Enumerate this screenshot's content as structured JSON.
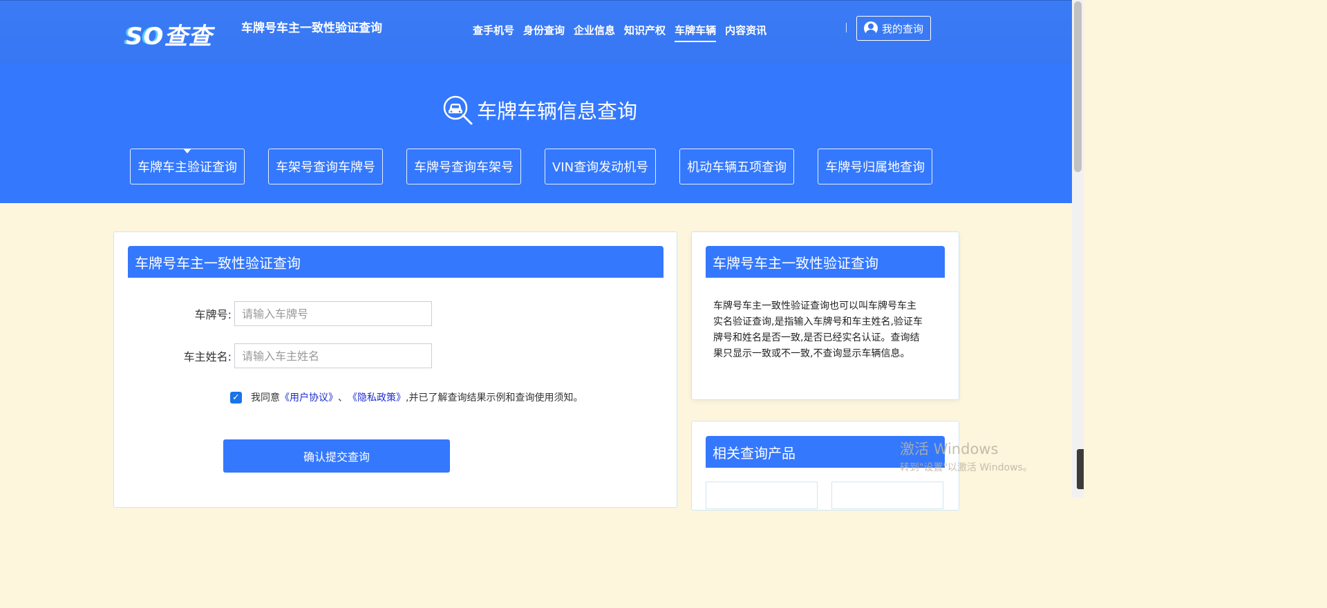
{
  "header": {
    "logo_text": "SO查查",
    "brand_title": "车牌号车主一致性验证查询",
    "nav": [
      "查手机号",
      "身份查询",
      "企业信息",
      "知识产权",
      "车牌车辆",
      "内容资讯"
    ],
    "nav_active": "车牌车辆",
    "my_query_label": "我的查询"
  },
  "hero": {
    "title": "车牌车辆信息查询",
    "icon": "car-search-icon",
    "tabs": [
      "车牌车主验证查询",
      "车架号查询车牌号",
      "车牌号查询车架号",
      "VIN查询发动机号",
      "机动车辆五项查询",
      "车牌号归属地查询"
    ]
  },
  "form": {
    "title": "车牌号车主一致性验证查询",
    "plate_label": "车牌号:",
    "plate_placeholder": "请输入车牌号",
    "owner_label": "车主姓名:",
    "owner_placeholder": "请输入车主姓名",
    "agree_prefix": "我同意",
    "user_agreement": "《用户协议》",
    "separator": "、",
    "privacy_policy": "《隐私政策》",
    "agree_suffix": ",并已了解查询结果示例和查询使用须知。",
    "agree_checked": true,
    "submit_label": "确认提交查询"
  },
  "sidebar": {
    "info_title": "车牌号车主一致性验证查询",
    "info_text": "车牌号车主一致性验证查询也可以叫车牌号车主实名验证查询,是指输入车牌号和车主姓名,验证车牌号和姓名是否一致,是否已经实名认证。查询结果只显示一致或不一致,不查询显示车辆信息。",
    "related_title": "相关查询产品"
  },
  "watermark": {
    "line1": "激活 Windows",
    "line2": "转到\"设置\"以激活 Windows。"
  },
  "colors": {
    "primary": "#3478fe",
    "page_bg": "#fdf6dd",
    "link": "#1a2ccf"
  }
}
